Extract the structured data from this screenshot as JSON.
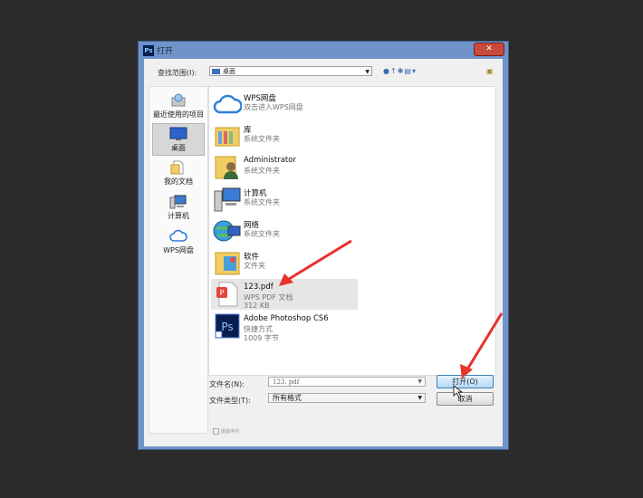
{
  "dialog": {
    "title": "打开",
    "app_icon_text": "Ps",
    "close_glyph": "✕"
  },
  "lookin": {
    "label": "查找范围(I):",
    "value": "桌面"
  },
  "places": [
    {
      "label": "最近使用的项目",
      "icon": "recent-icon"
    },
    {
      "label": "桌面",
      "icon": "desktop-icon",
      "selected": true
    },
    {
      "label": "我的文档",
      "icon": "documents-icon"
    },
    {
      "label": "计算机",
      "icon": "computer-icon"
    },
    {
      "label": "WPS网盘",
      "icon": "cloud-icon"
    }
  ],
  "files": [
    {
      "name": "WPS网盘",
      "sub1": "双击进入WPS网盘",
      "sub2": "",
      "icon": "cloud-icon"
    },
    {
      "name": "库",
      "sub1": "系统文件夹",
      "sub2": "",
      "icon": "library-icon"
    },
    {
      "name": "Administrator",
      "sub1": "系统文件夹",
      "sub2": "",
      "icon": "user-folder-icon"
    },
    {
      "name": "计算机",
      "sub1": "系统文件夹",
      "sub2": "",
      "icon": "computer-icon"
    },
    {
      "name": "网络",
      "sub1": "系统文件夹",
      "sub2": "",
      "icon": "network-icon"
    },
    {
      "name": "软件",
      "sub1": "文件夹",
      "sub2": "",
      "icon": "folder-icon"
    },
    {
      "name": "123.pdf",
      "sub1": "WPS PDF 文档",
      "sub2": "312 KB",
      "icon": "pdf-icon",
      "selected": true
    },
    {
      "name": "Adobe Photoshop CS6",
      "sub1": "快捷方式",
      "sub2": "1009 字节",
      "icon": "photoshop-icon"
    }
  ],
  "filename": {
    "label": "文件名(N):",
    "value": "123. pdf"
  },
  "filetype": {
    "label": "文件类型(T):",
    "value": "所有格式"
  },
  "buttons": {
    "open": "打开(O)",
    "cancel": "取消"
  },
  "preview": {
    "label": "图像序列"
  },
  "colors": {
    "titlebar": "#6f93c9",
    "close": "#c74a3a",
    "arrow": "#e8322b",
    "open_button": "#b5d8f5"
  }
}
